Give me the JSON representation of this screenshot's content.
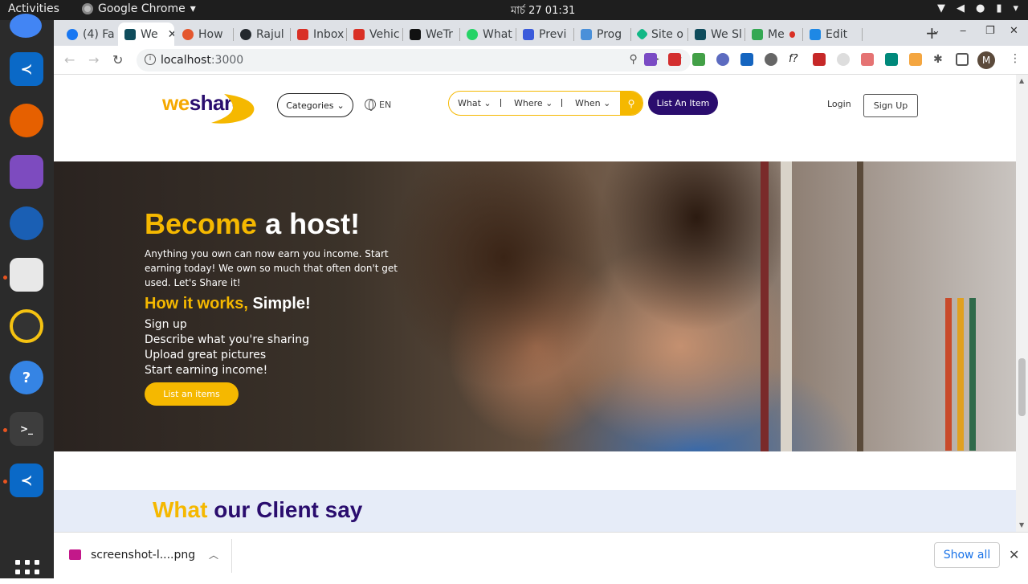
{
  "os": {
    "activities": "Activities",
    "app_name": "Google Chrome",
    "clock": "মার্চ 27  01:31"
  },
  "browser": {
    "tabs": [
      {
        "label": "(4) Fa",
        "color": "#1877f2"
      },
      {
        "label": "We",
        "color": "#0f4c5c",
        "active": true
      },
      {
        "label": "How",
        "color": "#e4572e"
      },
      {
        "label": "Rajul",
        "color": "#24292e"
      },
      {
        "label": "Inbox",
        "color": "#d93025"
      },
      {
        "label": "Vehic",
        "color": "#d93025"
      },
      {
        "label": "WeTr",
        "color": "#111111"
      },
      {
        "label": "What",
        "color": "#25d366"
      },
      {
        "label": "Previ",
        "color": "#3b5bdb"
      },
      {
        "label": "Prog",
        "color": "#4a90d9"
      },
      {
        "label": "Site o",
        "color": "#12b886"
      },
      {
        "label": "We Sl",
        "color": "#0f4c5c"
      },
      {
        "label": "Me",
        "color": "#34a853"
      },
      {
        "label": "Edit",
        "color": "#1e88e5"
      }
    ],
    "url_host": "localhost",
    "url_port": ":3000"
  },
  "site": {
    "logo_we": "we",
    "logo_share": "share",
    "categories": "Categories",
    "language": "EN",
    "search": {
      "what": "What",
      "where": "Where",
      "when": "When"
    },
    "list_item": "List An Item",
    "login": "Login",
    "signup": "Sign Up"
  },
  "hero": {
    "title_accent": "Become",
    "title_rest": " a host!",
    "description": "Anything you own can now earn you income. Start earning today! We own so much that often don't get used. Let's Share it!",
    "sub_accent": "How it works,",
    "sub_rest": " Simple!",
    "steps": [
      "Sign up",
      "Describe what you're sharing",
      "Upload great pictures",
      "Start earning income!"
    ],
    "cta": "List an items"
  },
  "clients": {
    "title_accent": "What",
    "title_rest": " our Client say"
  },
  "downloads": {
    "file_name": "screenshot-l....png",
    "show_all": "Show all"
  }
}
